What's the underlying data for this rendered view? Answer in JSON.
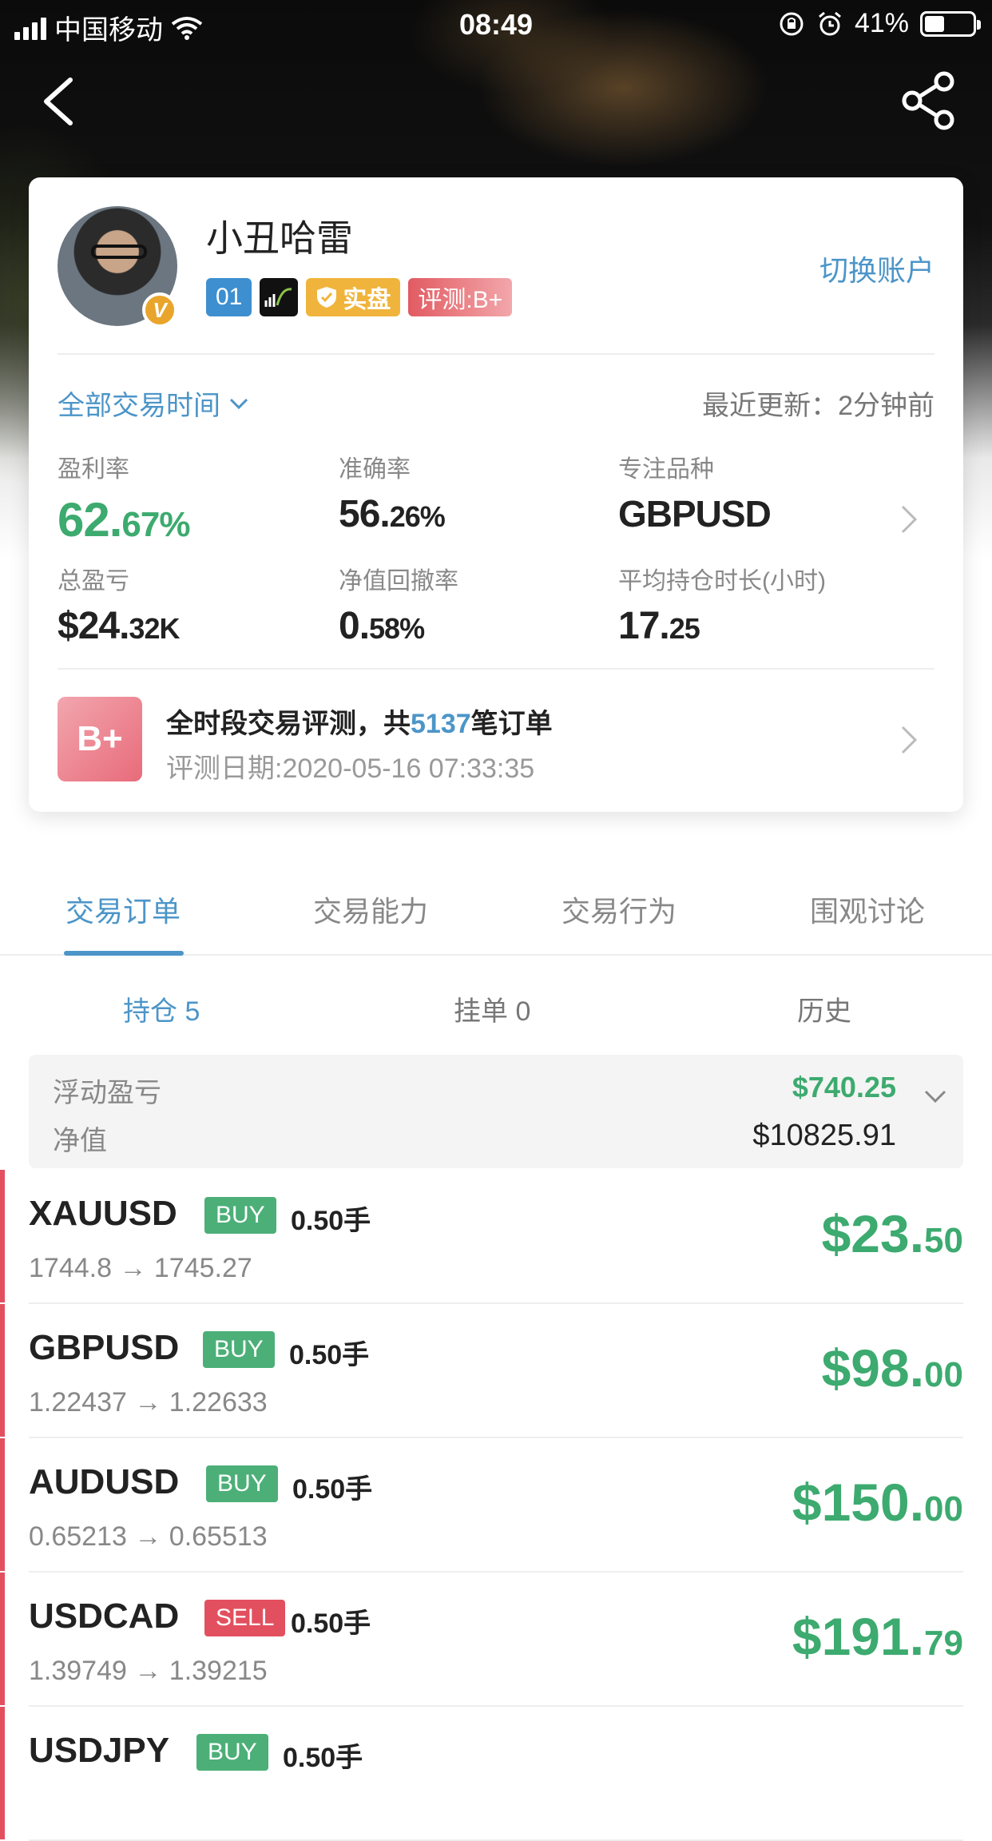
{
  "status_bar": {
    "carrier": "中国移动",
    "time": "08:49",
    "battery_pct": "41%",
    "battery_level": 0.41
  },
  "profile": {
    "name": "小丑哈雷",
    "badges": {
      "number": "01",
      "real": "实盘",
      "evaluation": "评测:B+"
    },
    "switch_account": "切换账户"
  },
  "filter": {
    "period": "全部交易时间",
    "updated_label": "最近更新：2分钟前"
  },
  "stats": {
    "profit_rate": {
      "label": "盈利率",
      "int": "62.",
      "dec": "67%"
    },
    "accuracy": {
      "label": "准确率",
      "int": "56.",
      "dec": "26%"
    },
    "focus_symbol": {
      "label": "专注品种",
      "value": "GBPUSD"
    },
    "total_pnl": {
      "label": "总盈亏",
      "int": "$24.",
      "dec": "32K"
    },
    "drawdown": {
      "label": "净值回撤率",
      "int": "0.",
      "dec": "58%"
    },
    "avg_hold": {
      "label": "平均持仓时长(小时)",
      "int": "17.",
      "dec": "25"
    }
  },
  "evaluation": {
    "grade": "B+",
    "title_prefix": "全时段交易评测，共",
    "order_count": "5137",
    "title_suffix": "笔订单",
    "date": "评测日期:2020-05-16 07:33:35"
  },
  "tabs": [
    "交易订单",
    "交易能力",
    "交易行为",
    "围观讨论"
  ],
  "subtabs": [
    "持仓 5",
    "挂单 0",
    "历史"
  ],
  "summary": {
    "floating_label": "浮动盈亏",
    "floating_value": "$740.25",
    "equity_label": "净值",
    "equity_value": "$10825.91"
  },
  "positions": [
    {
      "symbol": "XAUUSD",
      "side": "BUY",
      "lots": "0.50手",
      "prices": "1744.8 → 1745.27",
      "pnl_int": "$23.",
      "pnl_dec": "50"
    },
    {
      "symbol": "GBPUSD",
      "side": "BUY",
      "lots": "0.50手",
      "prices": "1.22437 → 1.22633",
      "pnl_int": "$98.",
      "pnl_dec": "00"
    },
    {
      "symbol": "AUDUSD",
      "side": "BUY",
      "lots": "0.50手",
      "prices": "0.65213 → 0.65513",
      "pnl_int": "$150.",
      "pnl_dec": "00"
    },
    {
      "symbol": "USDCAD",
      "side": "SELL",
      "lots": "0.50手",
      "prices": "1.39749 → 1.39215",
      "pnl_int": "$191.",
      "pnl_dec": "79"
    },
    {
      "symbol": "USDJPY",
      "side": "BUY",
      "lots": "0.50手",
      "prices": "",
      "pnl_int": "",
      "pnl_dec": ""
    }
  ],
  "colors": {
    "accent_blue": "#4c95c8",
    "profit_green": "#3daa6f",
    "buy_green": "#4caf78",
    "sell_red": "#e2505f"
  },
  "icons": [
    "back-arrow-icon",
    "share-icon",
    "verified-icon",
    "chevron-down-icon",
    "chevron-right-icon",
    "shield-check-icon"
  ]
}
